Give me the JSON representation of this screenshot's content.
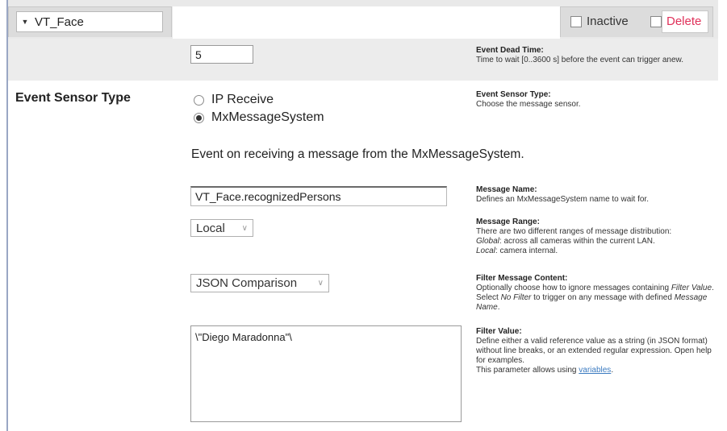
{
  "header": {
    "name_value": "VT_Face",
    "inactive_label": "Inactive",
    "delete_label": "Delete",
    "delete_color": "#e0315a"
  },
  "dead_time": {
    "value": "5",
    "help_title": "Event Dead Time:",
    "help_text": "Time to wait [0..3600 s] before the event can trigger anew."
  },
  "sensor": {
    "label": "Event Sensor Type",
    "options": [
      "IP Receive",
      "MxMessageSystem"
    ],
    "selected": "MxMessageSystem",
    "help_title": "Event Sensor Type:",
    "help_text": "Choose the message sensor."
  },
  "description": "Event on receiving a message from the MxMessageSystem.",
  "message_name": {
    "value": "VT_Face.recognizedPersons",
    "help_title": "Message Name:",
    "help_text": "Defines an MxMessageSystem name to wait for."
  },
  "message_range": {
    "value": "Local",
    "help_title": "Message Range:",
    "help_line1": "There are two different ranges of message distribution:",
    "help_global_term": "Global",
    "help_global_text": ": across all cameras within the current LAN.",
    "help_local_term": "Local",
    "help_local_text": ": camera internal."
  },
  "filter_content": {
    "value": "JSON Comparison",
    "help_title": "Filter Message Content:",
    "help_a": "Optionally choose how to ignore messages containing ",
    "help_b": "Filter Value",
    "help_c": ". Select ",
    "help_d": "No Filter",
    "help_e": " to trigger on any message with defined ",
    "help_f": "Message Name",
    "help_g": "."
  },
  "filter_value": {
    "value": "\\\"Diego Maradonna\"\\",
    "help_title": "Filter Value:",
    "help_text": "Define either a valid reference value as a string (in JSON format) without line breaks, or an extended regular expression. Open help for examples.",
    "help_vars_prefix": "This parameter allows using ",
    "help_vars_link": "variables",
    "help_vars_suffix": "."
  },
  "icons": {
    "caret": "triangle-down-icon",
    "radio": "radio-button",
    "checkbox": "checkbox"
  }
}
